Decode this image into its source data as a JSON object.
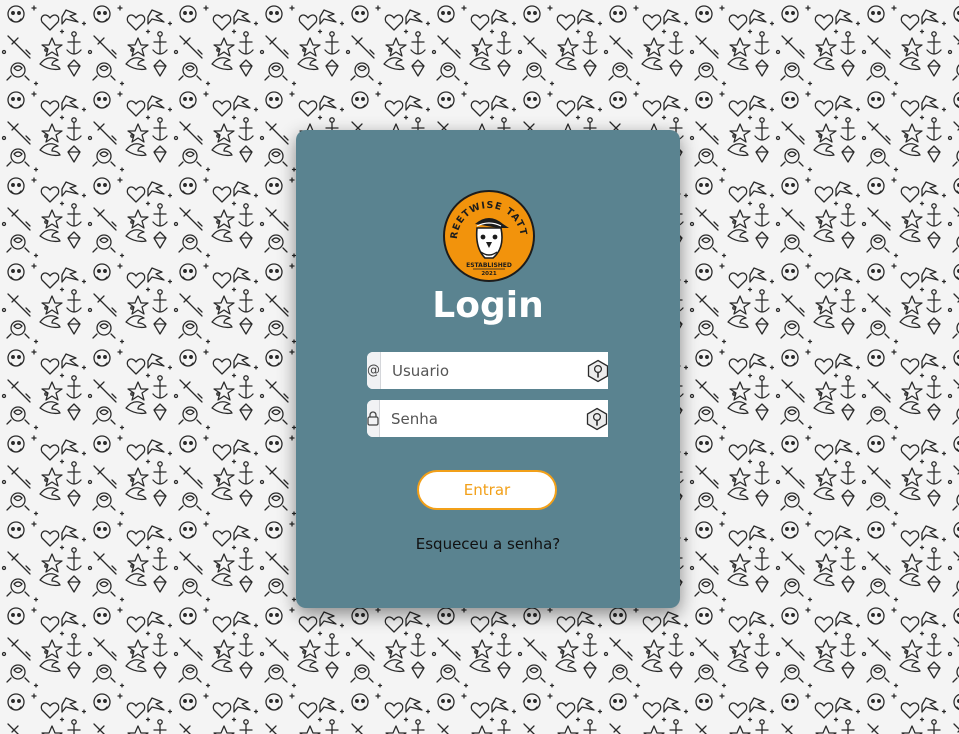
{
  "brand": {
    "logo_text_top": "STREETWISE TATTOO",
    "logo_text_bottom": "ESTABLISHED",
    "logo_year": "2021",
    "logo_color": "#f2930c"
  },
  "login": {
    "title": "Login",
    "username": {
      "prefix": "@",
      "placeholder": "Usuario",
      "value": ""
    },
    "password": {
      "placeholder": "Senha",
      "value": ""
    },
    "submit_label": "Entrar",
    "forgot_label": "Esqueceu a senha?"
  },
  "colors": {
    "card": "#5a8390",
    "accent": "#f2a019",
    "background": "#f4f4f4"
  }
}
